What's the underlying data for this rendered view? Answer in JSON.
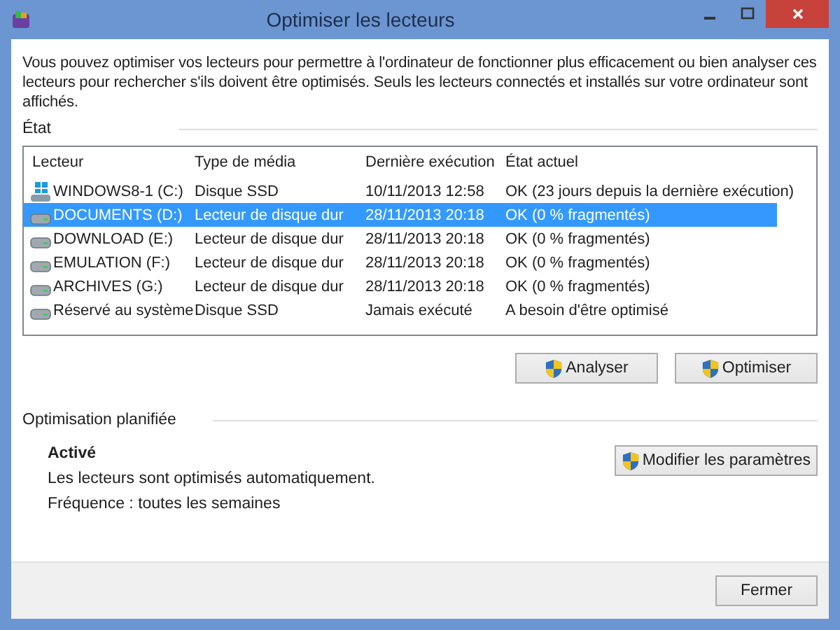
{
  "window": {
    "title": "Optimiser les lecteurs"
  },
  "intro": "Vous pouvez optimiser vos lecteurs pour permettre à l'ordinateur de fonctionner plus efficacement ou bien analyser ces lecteurs pour rechercher s'ils doivent être optimisés. Seuls les lecteurs connectés et installés sur votre ordinateur sont affichés.",
  "status_section": {
    "label": "État"
  },
  "table": {
    "columns": [
      "Lecteur",
      "Type de média",
      "Dernière exécution",
      "État actuel"
    ],
    "rows": [
      {
        "kind": "system",
        "selected": false,
        "cells": [
          "WINDOWS8-1 (C:)",
          "Disque SSD",
          "10/11/2013 12:58",
          "OK (23 jours depuis la dernière exécution)"
        ]
      },
      {
        "kind": "hdd",
        "selected": true,
        "cells": [
          "DOCUMENTS (D:)",
          "Lecteur de disque dur",
          "28/11/2013 20:18",
          "OK (0 % fragmentés)"
        ]
      },
      {
        "kind": "hdd",
        "selected": false,
        "cells": [
          "DOWNLOAD (E:)",
          "Lecteur de disque dur",
          "28/11/2013 20:18",
          "OK (0 % fragmentés)"
        ]
      },
      {
        "kind": "hdd",
        "selected": false,
        "cells": [
          "EMULATION (F:)",
          "Lecteur de disque dur",
          "28/11/2013 20:18",
          "OK (0 % fragmentés)"
        ]
      },
      {
        "kind": "hdd",
        "selected": false,
        "cells": [
          "ARCHIVES (G:)",
          "Lecteur de disque dur",
          "28/11/2013 20:18",
          "OK (0 % fragmentés)"
        ]
      },
      {
        "kind": "hdd",
        "selected": false,
        "cells": [
          "Réservé au système",
          "Disque SSD",
          "Jamais exécuté",
          "A besoin d'être optimisé"
        ]
      }
    ]
  },
  "actions": [
    "Analyser",
    "Optimiser"
  ],
  "schedule": {
    "label": "Optimisation planifiée",
    "status": "Activé",
    "description": "Les lecteurs sont optimisés automatiquement.",
    "frequency": "Fréquence : toutes les semaines",
    "button": "Modifier les paramètres"
  },
  "footer": {
    "button": "Fermer"
  }
}
